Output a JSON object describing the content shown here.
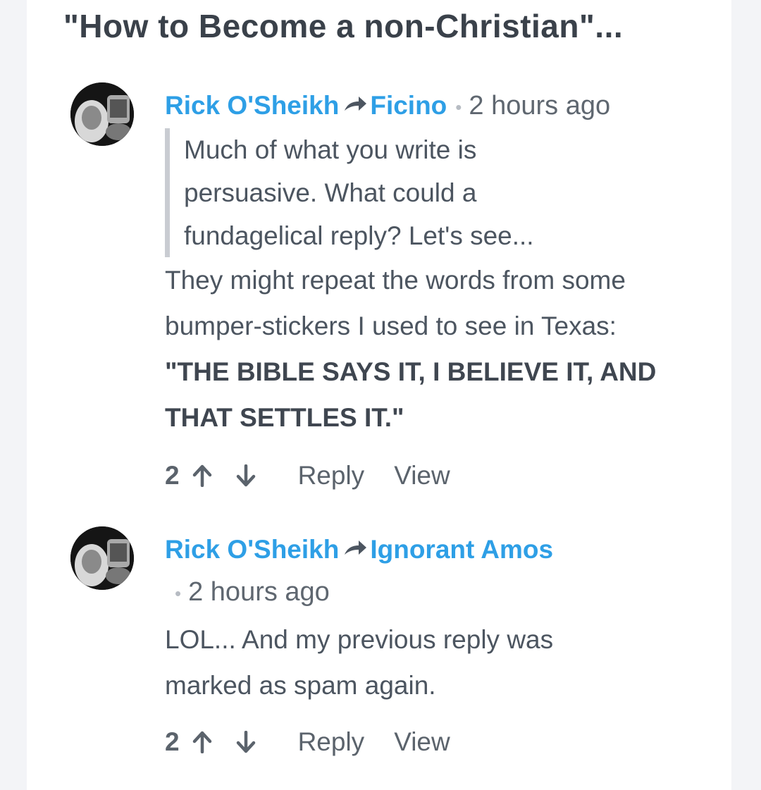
{
  "thread": {
    "title": "\"How to Become a non-Christian\"..."
  },
  "comments": [
    {
      "author": "Rick O'Sheikh",
      "recipient": "Ficino",
      "time": "2 hours ago",
      "quote": "Much of what you write is persuasive. What could a fundagelical reply? Let's see...",
      "body": "They might repeat the words from some bumper-stickers I used to see in Texas:",
      "body_bold": "\"THE BIBLE SAYS IT, I BELIEVE IT, AND THAT SETTLES IT.\"",
      "votes": "2",
      "reply_label": "Reply",
      "view_label": "View"
    },
    {
      "author": "Rick O'Sheikh",
      "recipient": "Ignorant Amos",
      "time": "2 hours ago",
      "body": "LOL... And my previous reply was marked as spam again.",
      "votes": "2",
      "reply_label": "Reply",
      "view_label": "View"
    }
  ],
  "colors": {
    "link": "#2e9fe6",
    "text": "#4c5560",
    "quote_border": "#c9ccd2"
  }
}
